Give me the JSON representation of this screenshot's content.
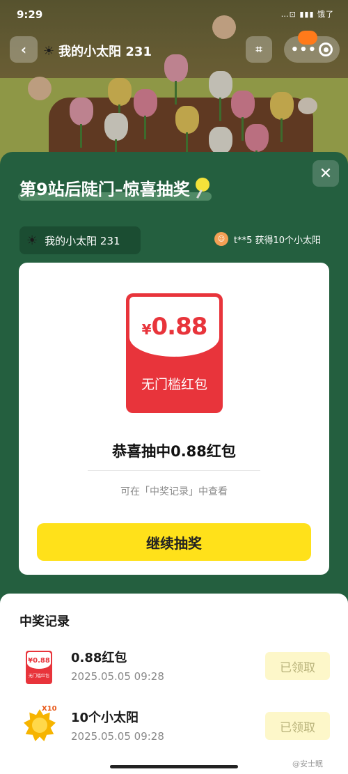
{
  "status_bar": {
    "time": "9:29",
    "icons": "…⊡ ▮▮▮ 饿了"
  },
  "nav": {
    "back_icon": "chevron-left-icon",
    "title_sun_icon": "☀",
    "title": "我的小太阳 231",
    "scan_icon": "qr-scan-icon",
    "capsule_more": "•••",
    "capsule_close_icon": "target-ring-icon"
  },
  "modal": {
    "title": "第9站后陡门–惊喜抽奖",
    "close_icon": "✕",
    "sun_badge": {
      "icon": "☀",
      "label": "我的小太阳 231"
    },
    "ticker": {
      "avatar_icon": "smiling-face-icon",
      "text": "t**5 获得10个小太阳"
    }
  },
  "prize_card": {
    "currency": "¥",
    "amount": "0.88",
    "envelope_label": "无门槛红包",
    "headline": "恭喜抽中0.88红包",
    "hint": "可在「中奖记录」中查看",
    "continue_button": "继续抽奖"
  },
  "records": {
    "title": "中奖记录",
    "items": [
      {
        "name": "0.88红包",
        "time": "2025.05.05 09:28",
        "status": "已领取",
        "thumb_amount": "¥0.88",
        "thumb_label": "无门槛红包"
      },
      {
        "name": "10个小太阳",
        "time": "2025.05.05 09:28",
        "status": "已领取",
        "thumb_multiplier": "X10"
      }
    ]
  },
  "watermark": "@安士眠",
  "colors": {
    "panel_green": "#245f3f",
    "red_envelope": "#e8343b",
    "yellow_button": "#ffe11a",
    "claimed_bg": "#fdf7c9"
  }
}
